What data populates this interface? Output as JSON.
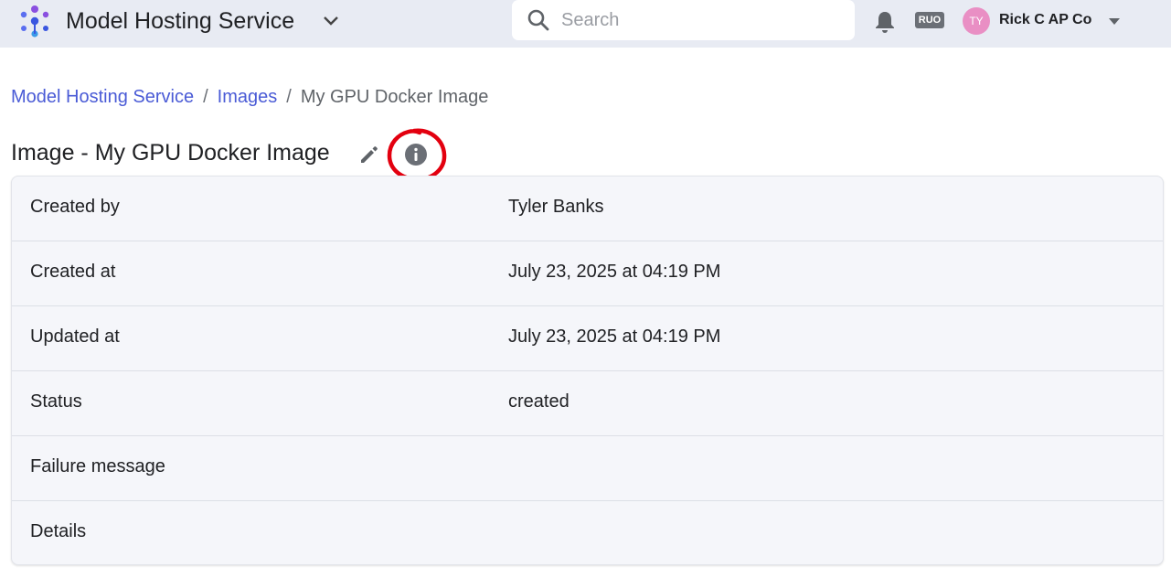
{
  "header": {
    "app_title": "Model Hosting Service",
    "search_placeholder": "Search",
    "badge": "RUO",
    "avatar_initials": "TY",
    "user_name": "Rick C AP Co"
  },
  "breadcrumb": {
    "items": [
      "Model Hosting Service",
      "Images"
    ],
    "separator": "/",
    "current": "My GPU Docker Image"
  },
  "page": {
    "title": "Image - My GPU Docker Image"
  },
  "details": {
    "rows": [
      {
        "label": "Created by",
        "value": "Tyler Banks"
      },
      {
        "label": "Created at",
        "value": "July 23, 2025 at 04:19 PM"
      },
      {
        "label": "Updated at",
        "value": "July 23, 2025 at 04:19 PM"
      },
      {
        "label": "Status",
        "value": "created"
      },
      {
        "label": "Failure message",
        "value": ""
      },
      {
        "label": "Details",
        "value": ""
      }
    ]
  },
  "colors": {
    "topbar_bg": "#e8ebf3",
    "link": "#4a5bd6",
    "panel_bg": "#f5f6fa",
    "highlight": "#e3000f",
    "avatar_bg": "#e98fc4"
  },
  "icons": [
    "app-logo-icon",
    "chevron-down-icon",
    "search-icon",
    "bell-icon",
    "caret-down-icon",
    "edit-pencil-icon",
    "info-icon"
  ]
}
